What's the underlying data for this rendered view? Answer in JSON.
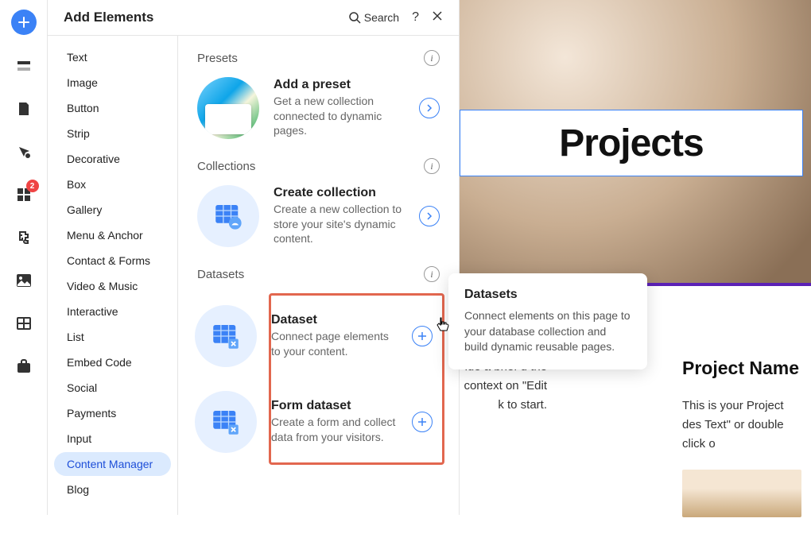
{
  "rail": {
    "badge": "2"
  },
  "panel": {
    "title": "Add Elements",
    "search_label": "Search"
  },
  "categories": [
    "Text",
    "Image",
    "Button",
    "Strip",
    "Decorative",
    "Box",
    "Gallery",
    "Menu & Anchor",
    "Contact & Forms",
    "Video & Music",
    "Interactive",
    "List",
    "Embed Code",
    "Social",
    "Payments",
    "Input",
    "Content Manager",
    "Blog"
  ],
  "active_category_index": 16,
  "sections": {
    "presets": {
      "title": "Presets",
      "card": {
        "title": "Add a preset",
        "desc": "Get a new collection connected to dynamic pages."
      }
    },
    "collections": {
      "title": "Collections",
      "card": {
        "title": "Create collection",
        "desc": "Create a new collection to store your site's dynamic content."
      }
    },
    "datasets": {
      "title": "Datasets",
      "cards": [
        {
          "title": "Dataset",
          "desc": "Connect page elements to your content."
        },
        {
          "title": "Form dataset",
          "desc": "Create a form and collect data from your visitors."
        }
      ]
    }
  },
  "tooltip": {
    "title": "Datasets",
    "desc": "Connect elements on this page to your database collection and build dynamic reusable pages."
  },
  "canvas": {
    "hero_title": "Projects",
    "project1": {
      "name": "Project Name",
      "desc_left": "ide a brief d the context on \"Edit k to start.",
      "desc_right": "This is your Project des Text\" or double click o"
    }
  }
}
